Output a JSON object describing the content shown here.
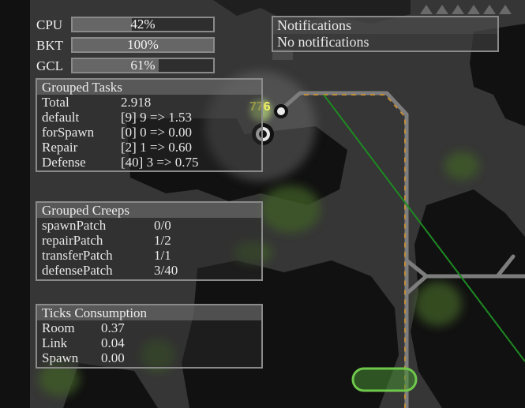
{
  "stats": [
    {
      "label": "CPU",
      "value": "42%",
      "fraction": 0.42
    },
    {
      "label": "BKT",
      "value": "100%",
      "fraction": 1.0
    },
    {
      "label": "GCL",
      "value": "61%",
      "fraction": 0.61
    }
  ],
  "grouped_tasks": {
    "title": "Grouped Tasks",
    "rows": [
      {
        "name": "Total",
        "value": "2.918"
      },
      {
        "name": "default",
        "value": "[9] 9 => 1.53"
      },
      {
        "name": "forSpawn",
        "value": "[0] 0 => 0.00"
      },
      {
        "name": "Repair",
        "value": "[2] 1 => 0.60"
      },
      {
        "name": "Defense",
        "value": "[40] 3 => 0.75"
      }
    ]
  },
  "grouped_creeps": {
    "title": "Grouped Creeps",
    "rows": [
      {
        "name": "spawnPatch",
        "value": "0/0"
      },
      {
        "name": "repairPatch",
        "value": "1/2"
      },
      {
        "name": "transferPatch",
        "value": "1/1"
      },
      {
        "name": "defensePatch",
        "value": "3/40"
      }
    ]
  },
  "ticks_consumption": {
    "title": "Ticks Consumption",
    "rows": [
      {
        "name": "Room",
        "value": "0.37"
      },
      {
        "name": "Link",
        "value": "0.04"
      },
      {
        "name": "Spawn",
        "value": "0.00"
      }
    ]
  },
  "notifications": {
    "title": "Notifications",
    "body": "No notifications"
  },
  "map": {
    "creep_label": "776",
    "colors": {
      "terrain": "#0e0e0e",
      "plain": "#3a3a3a",
      "swamp": "#3f5e26",
      "road": "#7d7d7d",
      "wall_rampart": "#c18f3a",
      "line": "#1e8a22",
      "highlight": "#6fc84b"
    }
  }
}
